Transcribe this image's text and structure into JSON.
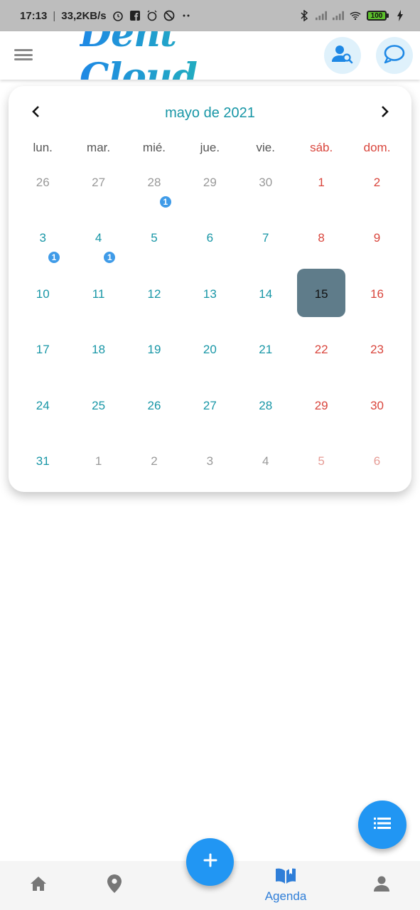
{
  "status_bar": {
    "time": "17:13",
    "speed": "33,2KB/s",
    "battery": "100",
    "icons": [
      "alarm-icon",
      "facebook-icon",
      "alarm-clock-icon",
      "blocked-icon",
      "more-icon",
      "bluetooth-icon",
      "signal-icon",
      "signal-icon",
      "wifi-icon",
      "battery-icon",
      "charging-icon"
    ]
  },
  "header": {
    "logo_text": "Dent Cloud",
    "menu_icon": "hamburger-icon",
    "search_icon": "user-search-icon",
    "chat_icon": "chat-icon"
  },
  "calendar": {
    "month_title": "mayo de 2021",
    "weekdays": [
      "lun.",
      "mar.",
      "mié.",
      "jue.",
      "vie.",
      "sáb.",
      "dom."
    ],
    "weeks": [
      [
        {
          "d": "26",
          "m": "other",
          "b": ""
        },
        {
          "d": "27",
          "m": "other",
          "b": ""
        },
        {
          "d": "28",
          "m": "other",
          "b": "1"
        },
        {
          "d": "29",
          "m": "other",
          "b": ""
        },
        {
          "d": "30",
          "m": "other",
          "b": ""
        },
        {
          "d": "1",
          "m": "cur",
          "b": ""
        },
        {
          "d": "2",
          "m": "cur",
          "b": ""
        }
      ],
      [
        {
          "d": "3",
          "m": "cur",
          "b": "1"
        },
        {
          "d": "4",
          "m": "cur",
          "b": "1"
        },
        {
          "d": "5",
          "m": "cur",
          "b": ""
        },
        {
          "d": "6",
          "m": "cur",
          "b": ""
        },
        {
          "d": "7",
          "m": "cur",
          "b": ""
        },
        {
          "d": "8",
          "m": "cur",
          "b": ""
        },
        {
          "d": "9",
          "m": "cur",
          "b": ""
        }
      ],
      [
        {
          "d": "10",
          "m": "cur",
          "b": ""
        },
        {
          "d": "11",
          "m": "cur",
          "b": ""
        },
        {
          "d": "12",
          "m": "cur",
          "b": ""
        },
        {
          "d": "13",
          "m": "cur",
          "b": ""
        },
        {
          "d": "14",
          "m": "cur",
          "b": ""
        },
        {
          "d": "15",
          "m": "today",
          "b": ""
        },
        {
          "d": "16",
          "m": "cur",
          "b": ""
        }
      ],
      [
        {
          "d": "17",
          "m": "cur",
          "b": ""
        },
        {
          "d": "18",
          "m": "cur",
          "b": ""
        },
        {
          "d": "19",
          "m": "cur",
          "b": ""
        },
        {
          "d": "20",
          "m": "cur",
          "b": ""
        },
        {
          "d": "21",
          "m": "cur",
          "b": ""
        },
        {
          "d": "22",
          "m": "cur",
          "b": ""
        },
        {
          "d": "23",
          "m": "cur",
          "b": ""
        }
      ],
      [
        {
          "d": "24",
          "m": "cur",
          "b": ""
        },
        {
          "d": "25",
          "m": "cur",
          "b": ""
        },
        {
          "d": "26",
          "m": "cur",
          "b": ""
        },
        {
          "d": "27",
          "m": "cur",
          "b": ""
        },
        {
          "d": "28",
          "m": "cur",
          "b": ""
        },
        {
          "d": "29",
          "m": "cur",
          "b": ""
        },
        {
          "d": "30",
          "m": "cur",
          "b": ""
        }
      ],
      [
        {
          "d": "31",
          "m": "cur",
          "b": ""
        },
        {
          "d": "1",
          "m": "other",
          "b": ""
        },
        {
          "d": "2",
          "m": "other",
          "b": ""
        },
        {
          "d": "3",
          "m": "other",
          "b": ""
        },
        {
          "d": "4",
          "m": "other",
          "b": ""
        },
        {
          "d": "5",
          "m": "other",
          "b": ""
        },
        {
          "d": "6",
          "m": "other",
          "b": ""
        }
      ]
    ]
  },
  "fab_list_icon": "list-icon",
  "fab_add_icon": "plus-icon",
  "bottom_nav": {
    "items": [
      {
        "icon": "home-icon",
        "label": ""
      },
      {
        "icon": "map-pin-icon",
        "label": ""
      },
      {
        "icon": "book-icon",
        "label": "Agenda"
      },
      {
        "icon": "person-icon",
        "label": ""
      }
    ]
  },
  "colors": {
    "accent": "#1796a6",
    "weekend": "#d9453c",
    "primary_blue": "#2196f3",
    "today_bg": "#5f7c8a"
  }
}
